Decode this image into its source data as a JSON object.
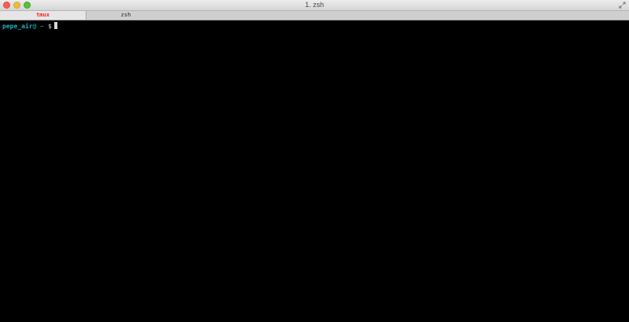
{
  "window": {
    "title": "1. zsh"
  },
  "tabs": [
    {
      "label": "tmux",
      "color": "#ff1d1d",
      "active": true
    },
    {
      "label": "zsh",
      "active": false
    }
  ],
  "terminal": {
    "prompt_user_host": "pepe_air",
    "prompt_path": "@ ~",
    "prompt_symbol": "$",
    "prompt_color": "#19b4c4",
    "input_text": ""
  },
  "icons": {
    "close": "close-icon",
    "minimize": "minimize-icon",
    "zoom": "zoom-icon",
    "fullscreen": "fullscreen-arrows-icon"
  }
}
